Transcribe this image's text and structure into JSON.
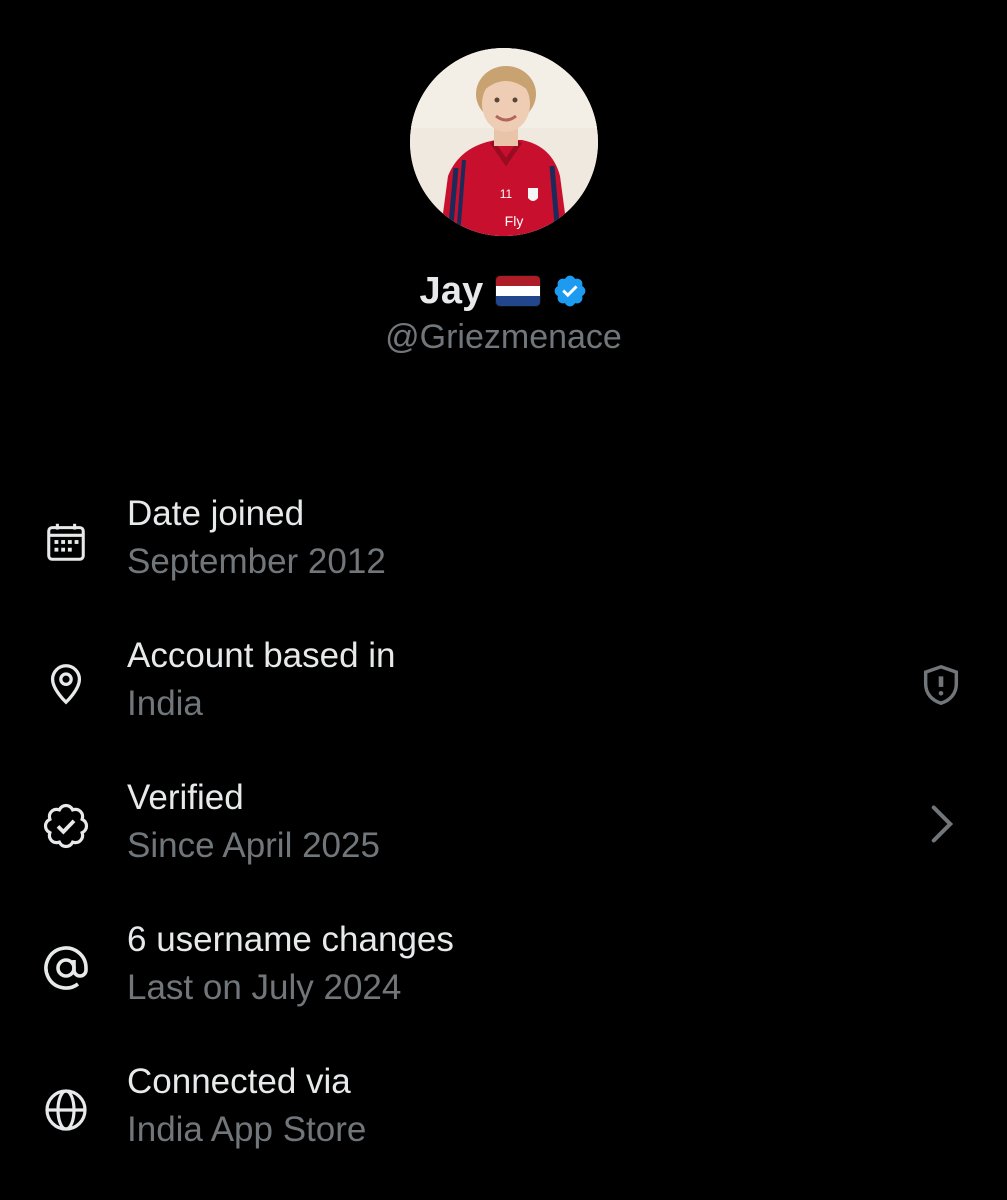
{
  "profile": {
    "display_name": "Jay",
    "flag_icon": "netherlands-flag-icon",
    "flag_colors": [
      "#AE1C28",
      "#FFFFFF",
      "#21468B"
    ],
    "verified_badge_icon": "verified-badge-icon",
    "verified_badge_color": "#1D9BF0",
    "handle": "@Griezmenace",
    "avatar_icon": "profile-photo"
  },
  "about": {
    "items": [
      {
        "icon": "calendar-icon",
        "title": "Date joined",
        "subtitle": "September 2012"
      },
      {
        "icon": "location-pin-icon",
        "title": "Account based in",
        "subtitle": "India",
        "trailing_icon": "shield-alert-icon"
      },
      {
        "icon": "verified-outline-icon",
        "title": "Verified",
        "subtitle": "Since April 2025",
        "trailing_icon": "chevron-right-icon"
      },
      {
        "icon": "at-sign-icon",
        "title": "6 username changes",
        "subtitle": "Last on July 2024"
      },
      {
        "icon": "globe-icon",
        "title": "Connected via",
        "subtitle": "India App Store"
      }
    ]
  },
  "colors": {
    "background": "#000000",
    "primary_text": "#E7E9EA",
    "secondary_text": "#71767B"
  }
}
